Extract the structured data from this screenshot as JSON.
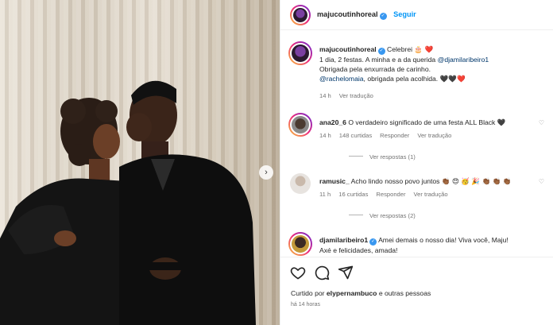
{
  "post": {
    "author": "majucoutinhoreal",
    "follow_label": "Seguir",
    "verified_mark": "✓"
  },
  "caption": {
    "user": "majucoutinhoreal",
    "first_line": "Celebrei 🎂 ❤️",
    "line2_prefix": "1 dia, 2 festas. A minha e a da querida ",
    "mention1": "@djamilaribeiro1",
    "line3": "Obrigada pela enxurrada de carinho.",
    "mention2": "@rachelomaia",
    "line4_suffix": ", obrigada pela acolhida. 🖤🖤❤️",
    "time": "14 h",
    "translate": "Ver tradução"
  },
  "comments": [
    {
      "user": "ana20_6",
      "text": "O verdadeiro significado de uma festa ALL Black 🖤",
      "time": "14 h",
      "likes": "148 curtidas",
      "reply": "Responder",
      "translate": "Ver tradução",
      "replies": "Ver respostas (1)"
    },
    {
      "user": "ramusic_",
      "text": "Acho lindo nosso povo juntos 👏🏾 😍 🥳 🎉  👏🏾 👏🏾 👏🏾",
      "time": "11 h",
      "likes": "16 curtidas",
      "reply": "Responder",
      "translate": "Ver tradução",
      "replies": "Ver respostas (2)"
    },
    {
      "user": "djamilaribeiro1",
      "text": "Amei demais o nosso dia! Viva você, Maju!",
      "text2": "Axé e felicidades, amada!"
    }
  ],
  "footer": {
    "liked_prefix": "Curtido por ",
    "liked_user": "elypernambuco",
    "liked_suffix": " e outras pessoas",
    "time": "há 14 horas"
  },
  "colors": {
    "follow": "#0095f6",
    "verified": "#3897f0",
    "mention": "#00376b",
    "muted": "#737373"
  }
}
